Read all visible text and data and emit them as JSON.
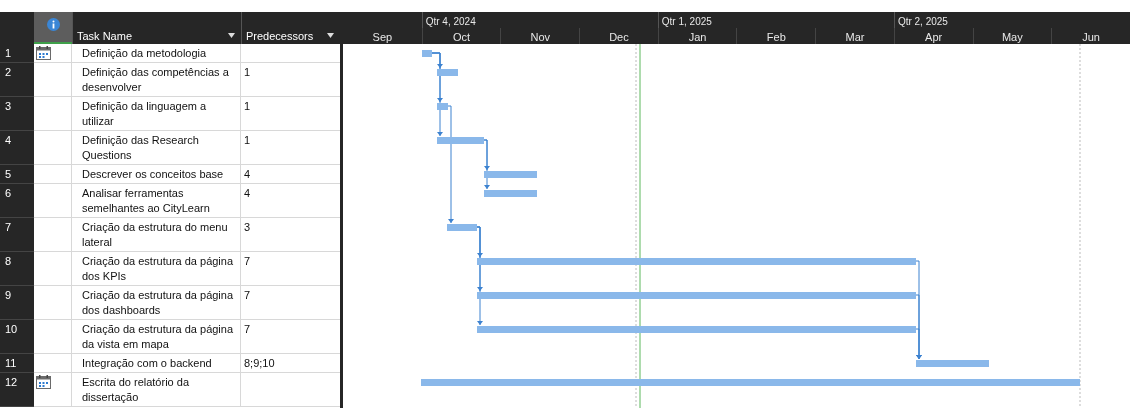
{
  "table": {
    "columns": [
      {
        "label": "Task Name"
      },
      {
        "label": "Predecessors"
      }
    ],
    "rows": [
      {
        "id": "1",
        "has_calendar": true,
        "name": "Definição da metodologia",
        "predecessors": ""
      },
      {
        "id": "2",
        "name": "Definição das competências a desenvolver",
        "predecessors": "1"
      },
      {
        "id": "3",
        "name": "Definição da linguagem a utilizar",
        "predecessors": "1"
      },
      {
        "id": "4",
        "name": "Definição das Research Questions",
        "predecessors": "1"
      },
      {
        "id": "5",
        "name": "Descrever os conceitos base",
        "predecessors": "4"
      },
      {
        "id": "6",
        "name": "Analisar ferramentas semelhantes ao CityLearn",
        "predecessors": "4"
      },
      {
        "id": "7",
        "name": "Criação da estrutura do menu lateral",
        "predecessors": "3"
      },
      {
        "id": "8",
        "name": "Criação da estrutura da página dos KPIs",
        "predecessors": "7"
      },
      {
        "id": "9",
        "name": "Criação da estrutura da página dos dashboards",
        "predecessors": "7"
      },
      {
        "id": "10",
        "name": "Criação da estrutura da página da vista em mapa",
        "predecessors": "7"
      },
      {
        "id": "11",
        "name": "Integração com o backend",
        "predecessors": "8;9;10"
      },
      {
        "id": "12",
        "has_calendar": true,
        "name": "Escrita do relatório da dissertação",
        "predecessors": ""
      }
    ]
  },
  "timescale": {
    "quarters": [
      "Qtr 4, 2024",
      "Qtr 1, 2025",
      "Qtr 2, 2025"
    ],
    "months": [
      "Sep",
      "Oct",
      "Nov",
      "Dec",
      "Jan",
      "Feb",
      "Mar",
      "Apr",
      "May",
      "Jun"
    ]
  }
}
